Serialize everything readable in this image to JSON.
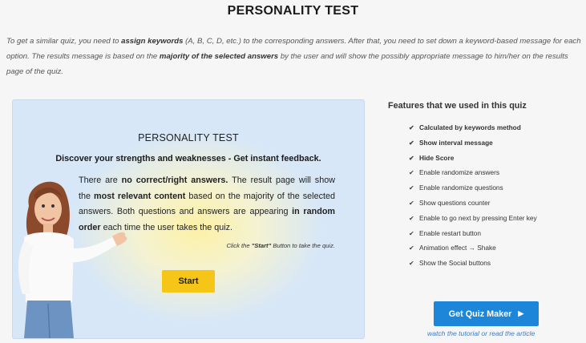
{
  "header": {
    "title": "PERSONALITY TEST"
  },
  "intro": {
    "part1": "To get a similar quiz, you need to ",
    "bold1": "assign keywords",
    "part2": " (A, B, C, D, etc.) to the corresponding answers. After that, you need to set down a keyword-based message for each option. The results message is based on the ",
    "bold2": "majority of the selected answers",
    "part3": " by the user and will show the possibly appropriate message to him/her on the results page of the quiz."
  },
  "quiz": {
    "title": "PERSONALITY TEST",
    "subtitle": "Discover your strengths and weaknesses - Get instant feedback.",
    "desc": {
      "t1": "There are ",
      "b1": "no correct/right answers.",
      "t2": " The result page will show the ",
      "b2": "most relevant content",
      "t3": " based on the majority of the selected answers.  Both questions and answers are appearing ",
      "b3": "in random order",
      "t4": " each time the user takes the quiz."
    },
    "hint": {
      "pre": "Click the ",
      "bold": "\"Start\"",
      "post": " Button to take the quiz."
    },
    "start_label": "Start"
  },
  "features": {
    "title": "Features that we used in this quiz",
    "items": [
      "Calculated by keywords method",
      "Show interval message",
      "Hide Score",
      "Enable randomize answers",
      "Enable randomize questions",
      "Show questions counter",
      "Enable to go next by pressing Enter key",
      "Enable restart button",
      "Animation effect → Shake",
      "Show the Social buttons"
    ]
  },
  "cta": {
    "button_label": "Get Quiz Maker",
    "play_icon": "▶",
    "link1": "watch the tutorial",
    "link_sep": " or ",
    "link2": "read the article"
  },
  "icons": {
    "check": "check-icon",
    "play": "play-icon"
  },
  "colors": {
    "start_button": "#f5c518",
    "cta_button": "#1e86d9",
    "card_bg": "#d7e7f8"
  }
}
